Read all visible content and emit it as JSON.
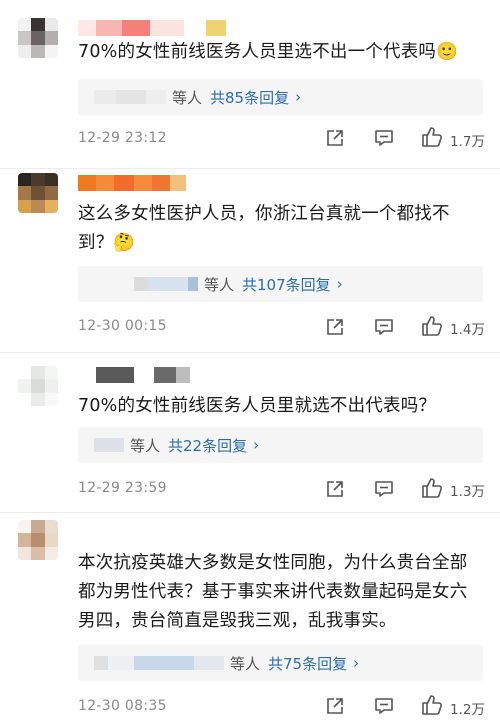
{
  "comments": [
    {
      "text": "70%的女性前线医务人员里选不出一个代表吗🙂",
      "reply_who": "等人",
      "reply_count": "共85条回复",
      "time": "12-29 23:12",
      "likes": "1.7万"
    },
    {
      "text": "这么多女性医护人员，你浙江台真就一个都找不到？🤔",
      "reply_who": "等人",
      "reply_count": "共107条回复",
      "time": "12-30 00:15",
      "likes": "1.4万"
    },
    {
      "text": "70%的女性前线医务人员里就选不出代表吗？",
      "reply_who": "等人",
      "reply_count": "共22条回复",
      "time": "12-29 23:59",
      "likes": "1.3万"
    },
    {
      "text": "本次抗疫英雄大多数是女性同胞，为什么贵台全部都为男性代表？基于事实来讲代表数量起码是女六男四，贵台简直是毁我三观，乱我事实。",
      "reply_who": "等人",
      "reply_count": "共75条回复",
      "time": "12-30 08:35",
      "likes": "1.2万"
    }
  ],
  "reply_chevron": "›",
  "icons": {
    "share": "share-icon",
    "comment": "comment-icon",
    "like": "thumbs-up-icon"
  },
  "colors": {
    "link": "#2b6cb0",
    "meta": "#8a8a8a",
    "reply_bg": "#f5f5f5"
  }
}
